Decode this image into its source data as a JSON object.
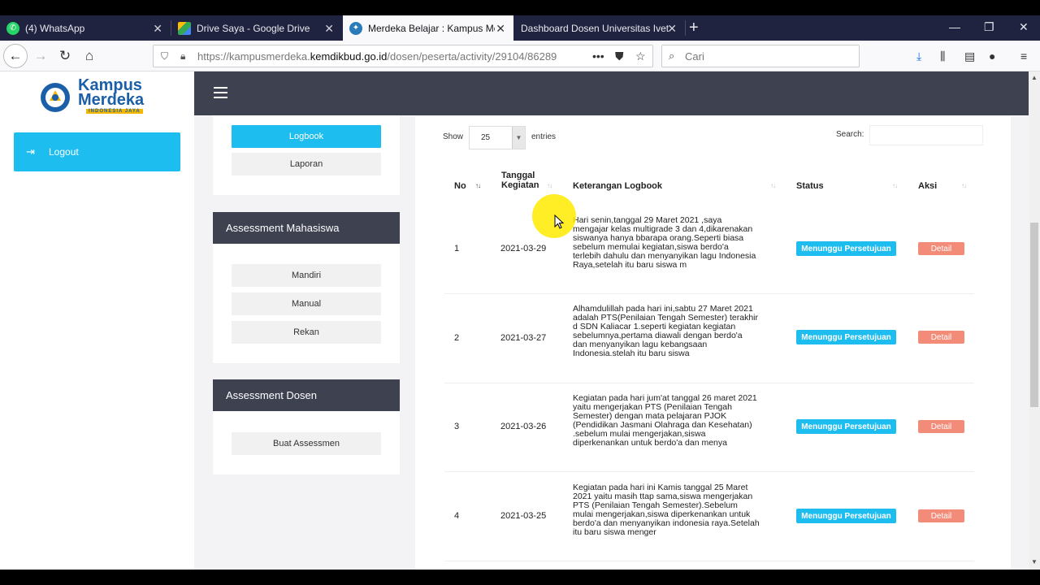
{
  "browser": {
    "tabs": [
      {
        "title": "(4) WhatsApp",
        "icon": "whatsapp-icon",
        "active": false
      },
      {
        "title": "Drive Saya - Google Drive",
        "icon": "google-drive-icon",
        "active": false
      },
      {
        "title": "Merdeka Belajar : Kampus Merdeka",
        "icon": "kemdikbud-icon",
        "active": true
      },
      {
        "title": "Dashboard Dosen Universitas Ivet",
        "icon": "",
        "active": false
      }
    ],
    "url_prefix": "https://kampusmerdeka.",
    "url_domain": "kemdikbud.go.id",
    "url_path": "/dosen/peserta/activity/29104/86289",
    "search_placeholder": "Cari",
    "accent": "#202340"
  },
  "sidebar": {
    "logo_line1": "Kampus",
    "logo_line2": "Merdeka",
    "logo_tagline": "INDONESIA JAYA",
    "logout_label": "Logout"
  },
  "activity_menu": {
    "logbook_label": "Logbook",
    "laporan_label": "Laporan"
  },
  "assessment_mahasiswa": {
    "title": "Assessment Mahasiswa",
    "items": [
      "Mandiri",
      "Manual",
      "Rekan"
    ]
  },
  "assessment_dosen": {
    "title": "Assessment Dosen",
    "button": "Buat Assessmen"
  },
  "table": {
    "show_label": "Show",
    "page_size": "25",
    "entries_label": "entries",
    "search_label": "Search:",
    "headers": {
      "no": "No",
      "date_line1": "Tanggal",
      "date_line2": "Kegiatan",
      "desc": "Keterangan Logbook",
      "status": "Status",
      "action": "Aksi"
    },
    "rows": [
      {
        "no": "1",
        "date": "2021-03-29",
        "desc_lines": [
          "Hari senin,tanggal 29 Maret 2021 ,saya",
          "mengajar kelas multigrade 3 dan 4,dikarenakan",
          "siswanya hanya bbarapa orang.Seperti biasa",
          "sebelum memulai kegiatan,siswa berdo'a",
          "terlebih dahulu dan menyanyikan lagu Indonesia",
          "Raya,setelah itu baru siswa m"
        ],
        "status": "Menunggu Persetujuan",
        "action": "Detail"
      },
      {
        "no": "2",
        "date": "2021-03-27",
        "desc_lines": [
          "Alhamdulillah pada hari ini,sabtu 27 Maret 2021",
          "adalah PTS(Penilaian Tengah Semester) terakhir",
          "d SDN Kaliacar 1.seperti kegiatan kegiatan",
          "sebelumnya,pertama diawali dengan berdo'a",
          "dan menyanyikan lagu kebangsaan",
          "Indonesia.stelah itu baru siswa"
        ],
        "status": "Menunggu Persetujuan",
        "action": "Detail"
      },
      {
        "no": "3",
        "date": "2021-03-26",
        "desc_lines": [
          "Kegiatan pada hari jum'at tanggal 26 maret 2021",
          "yaitu mengerjakan PTS (Penilaian Tengah",
          "Semester) dengan mata pelajaran PJOK",
          "(Pendidikan Jasmani Olahraga dan Kesehatan)",
          ".sebelum mulai mengerjakan,siswa",
          "diperkenankan untuk berdo'a dan menya"
        ],
        "status": "Menunggu Persetujuan",
        "action": "Detail"
      },
      {
        "no": "4",
        "date": "2021-03-25",
        "desc_lines": [
          "Kegiatan pada hari ini Kamis tanggal 25 Maret",
          "2021 yaitu masih ttap sama,siswa mengerjakan",
          "PTS (Penilaian Tengah Semester).Sebelum",
          "mulai mengerjakan,siswa diperkenankan untuk",
          "berdo'a dan menyanyikan indonesia raya.Setelah",
          "itu baru siswa menger"
        ],
        "status": "Menunggu Persetujuan",
        "action": "Detail"
      }
    ]
  },
  "colors": {
    "primary": "#1ebdf0",
    "dark": "#3d4150",
    "detail": "#f28b78"
  }
}
